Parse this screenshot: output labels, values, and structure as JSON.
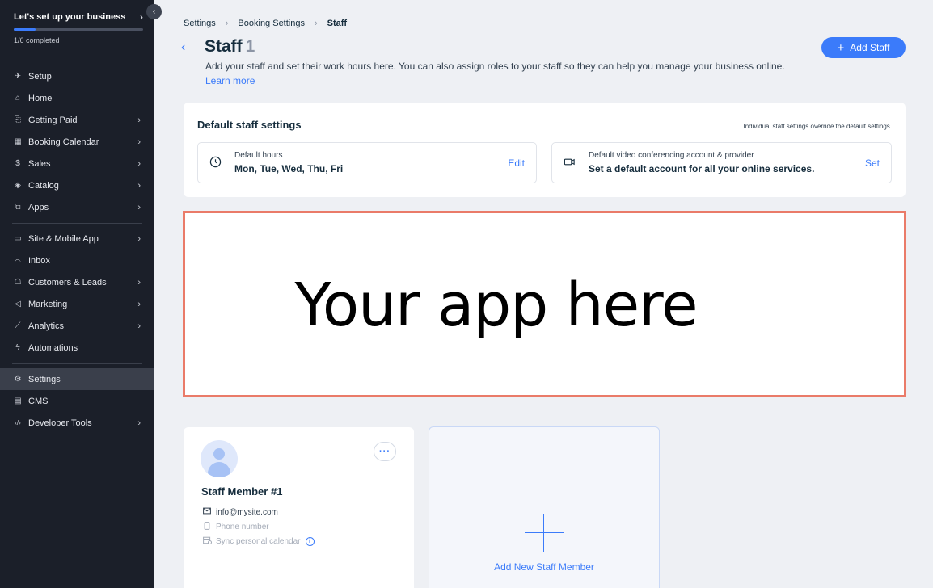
{
  "sidebar": {
    "setup": {
      "title": "Let's set up your business",
      "progress_text": "1/6 completed",
      "progress_fraction": 0.167
    },
    "groups": [
      [
        {
          "label": "Setup",
          "icon": "rocket-icon",
          "glyph": "✈",
          "arrow": false
        },
        {
          "label": "Home",
          "icon": "home-icon",
          "glyph": "⌂",
          "arrow": false
        },
        {
          "label": "Getting Paid",
          "icon": "payment-icon",
          "glyph": "⎘",
          "arrow": true
        },
        {
          "label": "Booking Calendar",
          "icon": "calendar-icon",
          "glyph": "▦",
          "arrow": true
        },
        {
          "label": "Sales",
          "icon": "dollar-icon",
          "glyph": "$",
          "arrow": true
        },
        {
          "label": "Catalog",
          "icon": "catalog-icon",
          "glyph": "◈",
          "arrow": true
        },
        {
          "label": "Apps",
          "icon": "apps-icon",
          "glyph": "⧉",
          "arrow": true
        }
      ],
      [
        {
          "label": "Site & Mobile App",
          "icon": "site-icon",
          "glyph": "▭",
          "arrow": true
        },
        {
          "label": "Inbox",
          "icon": "inbox-icon",
          "glyph": "⌓",
          "arrow": false
        },
        {
          "label": "Customers & Leads",
          "icon": "customers-icon",
          "glyph": "☖",
          "arrow": true
        },
        {
          "label": "Marketing",
          "icon": "megaphone-icon",
          "glyph": "◁",
          "arrow": true
        },
        {
          "label": "Analytics",
          "icon": "analytics-icon",
          "glyph": "⟋",
          "arrow": true
        },
        {
          "label": "Automations",
          "icon": "automations-icon",
          "glyph": "ϟ",
          "arrow": false
        }
      ],
      [
        {
          "label": "Settings",
          "icon": "gear-icon",
          "glyph": "⚙",
          "arrow": false,
          "active": true
        },
        {
          "label": "CMS",
          "icon": "cms-icon",
          "glyph": "▤",
          "arrow": false
        },
        {
          "label": "Developer Tools",
          "icon": "code-icon",
          "glyph": "‹/›",
          "arrow": true
        }
      ]
    ]
  },
  "breadcrumb": {
    "items": [
      "Settings",
      "Booking Settings",
      "Staff"
    ]
  },
  "header": {
    "title": "Staff",
    "count": "1",
    "description": "Add your staff and set their work hours here. You can also assign roles to your staff so they can help you manage your business online.",
    "learn_more": "Learn more",
    "add_staff_label": "Add Staff"
  },
  "default_settings": {
    "title": "Default staff settings",
    "note": "Individual staff settings override the default settings.",
    "hours": {
      "label": "Default hours",
      "value": "Mon, Tue, Wed, Thu, Fri",
      "action": "Edit"
    },
    "video": {
      "label": "Default video conferencing account & provider",
      "value": "Set a default account for all your online services.",
      "action": "Set"
    }
  },
  "app_placeholder": {
    "text": "Your app here"
  },
  "staff_card": {
    "name": "Staff Member #1",
    "email": "info@mysite.com",
    "phone": "Phone number",
    "sync": "Sync personal calendar",
    "more": "···"
  },
  "add_card": {
    "label": "Add New Staff Member"
  },
  "colors": {
    "accent": "#3b7bfa",
    "sidebar_bg": "#1b1f29",
    "highlight_border": "#ea7b69"
  }
}
